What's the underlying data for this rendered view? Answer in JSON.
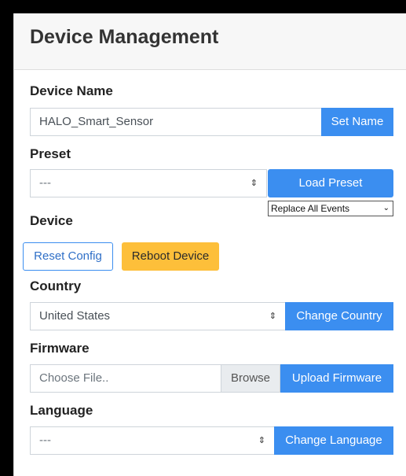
{
  "header": {
    "title": "Device Management"
  },
  "device_name": {
    "label": "Device Name",
    "value": "HALO_Smart_Sensor",
    "button": "Set Name"
  },
  "preset": {
    "label": "Preset",
    "selected": "---",
    "button": "Load Preset",
    "mode_selected": "Replace All Events"
  },
  "device": {
    "label": "Device",
    "reset_button": "Reset Config",
    "reboot_button": "Reboot Device"
  },
  "country": {
    "label": "Country",
    "selected": "United States",
    "button": "Change Country"
  },
  "firmware": {
    "label": "Firmware",
    "placeholder": "Choose File..",
    "browse": "Browse",
    "button": "Upload Firmware"
  },
  "language": {
    "label": "Language",
    "selected": "---",
    "button": "Change Language"
  },
  "icons": {
    "select_caret": "⇕",
    "dropdown_chevron": "⌄"
  },
  "colors": {
    "primary": "#3b8ef0",
    "warning": "#fdbf3a",
    "header_bg": "#f7f7f7"
  }
}
